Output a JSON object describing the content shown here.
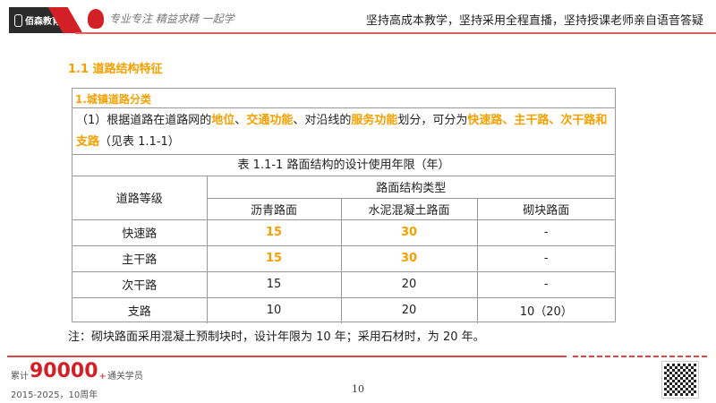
{
  "header": {
    "logo_text": "佰森教育",
    "slogan": "专业专注 精益求精 一起学",
    "tagline": "坚持高成本教学，坚持采用全程直播，坚持授课老师亲自语音答疑"
  },
  "section_title": "1.1 道路结构特征",
  "box": {
    "subtitle": "1.城镇道路分类",
    "para": {
      "p1": "（1）根据道路在道路网的",
      "h1": "地位",
      "p2": "、",
      "h2": "交通功能",
      "p3": "、对沿线的",
      "h3": "服务功能",
      "p4": "划分，可分为",
      "h4": "快速路、主干路、次干路和支路",
      "p5": "（见表 1.1-1）"
    },
    "table_title": "表 1.1-1 路面结构的设计使用年限（年）",
    "head": {
      "grade": "道路等级",
      "type": "路面结构类型",
      "cols": [
        "沥青路面",
        "水泥混凝土路面",
        "砌块路面"
      ]
    },
    "rows": [
      {
        "grade": "快速路",
        "v": [
          "15",
          "30",
          "-"
        ]
      },
      {
        "grade": "主干路",
        "v": [
          "15",
          "30",
          "-"
        ]
      },
      {
        "grade": "次干路",
        "v": [
          "15",
          "20",
          "-"
        ]
      },
      {
        "grade": "支路",
        "v": [
          "10",
          "20",
          "10（20）"
        ]
      }
    ]
  },
  "note": "注：砌块路面采用混凝土预制块时，设计年限为 10 年；采用石材时，为 20 年。",
  "footer": {
    "prefix": "累计",
    "count": "90000",
    "plus": "+",
    "suffix": "通关学员",
    "years": "2015-2025，10周年",
    "page": "10"
  },
  "colors": {
    "accent": "#f5a000",
    "brand": "#d32027"
  }
}
